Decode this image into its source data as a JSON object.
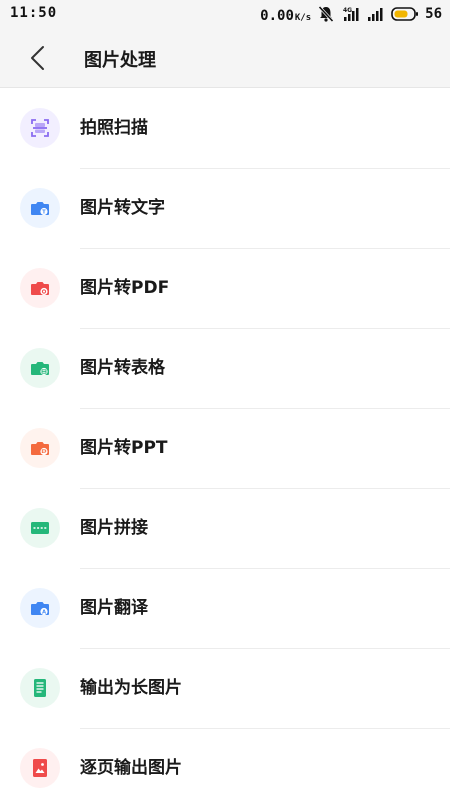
{
  "status_bar": {
    "time": "11:50",
    "net_speed": "0.00",
    "net_unit": "K/s",
    "battery": "56",
    "battery_color": "#f2b600"
  },
  "header": {
    "back_icon": "chevron-left-icon",
    "title": "图片处理"
  },
  "items": [
    {
      "label": "拍照扫描",
      "icon": "scan-icon",
      "bg": "#f2efff",
      "color": "#8a6cf0"
    },
    {
      "label": "图片转文字",
      "icon": "camera-text-icon",
      "bg": "#ecf4ff",
      "color": "#3f86f2"
    },
    {
      "label": "图片转PDF",
      "icon": "camera-pdf-icon",
      "bg": "#fff0f0",
      "color": "#ef4b4b"
    },
    {
      "label": "图片转表格",
      "icon": "camera-sheet-icon",
      "bg": "#eaf8f1",
      "color": "#25b77a"
    },
    {
      "label": "图片转PPT",
      "icon": "camera-ppt-icon",
      "bg": "#fff3ee",
      "color": "#f46a3e"
    },
    {
      "label": "图片拼接",
      "icon": "image-stitch-icon",
      "bg": "#eaf8f1",
      "color": "#25b77a"
    },
    {
      "label": "图片翻译",
      "icon": "camera-translate-icon",
      "bg": "#ecf4ff",
      "color": "#3f86f2"
    },
    {
      "label": "输出为长图片",
      "icon": "long-image-icon",
      "bg": "#eaf8f1",
      "color": "#25b77a"
    },
    {
      "label": "逐页输出图片",
      "icon": "page-image-icon",
      "bg": "#fff0f0",
      "color": "#ef4b4b"
    }
  ]
}
